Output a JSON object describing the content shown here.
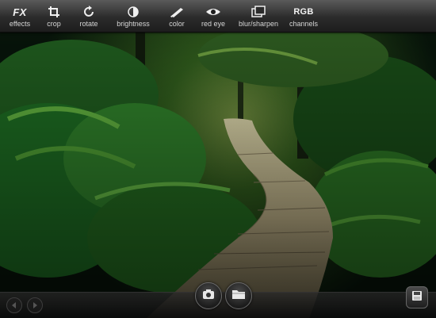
{
  "toolbar": {
    "tools": [
      {
        "label": "effects",
        "icon": "fx-icon",
        "glyph": "FX"
      },
      {
        "label": "crop",
        "icon": "crop-icon"
      },
      {
        "label": "rotate",
        "icon": "rotate-icon"
      },
      {
        "label": "brightness",
        "icon": "brightness-icon"
      },
      {
        "label": "color",
        "icon": "color-brush-icon"
      },
      {
        "label": "red eye",
        "icon": "eye-icon"
      },
      {
        "label": "blur/sharpen",
        "icon": "blur-sharpen-icon"
      },
      {
        "label": "channels",
        "icon": "rgb-icon",
        "glyph": "RGB"
      }
    ]
  },
  "photo": {
    "subject": "forest-boardwalk-image"
  },
  "bottom": {
    "prev_icon": "arrow-left-icon",
    "next_icon": "arrow-right-icon",
    "center_buttons": [
      "camera-icon",
      "folder-icon"
    ],
    "right_button": "save-icon"
  },
  "colors": {
    "toolbar": "#2b2b2b",
    "label": "#d5d5d5"
  }
}
